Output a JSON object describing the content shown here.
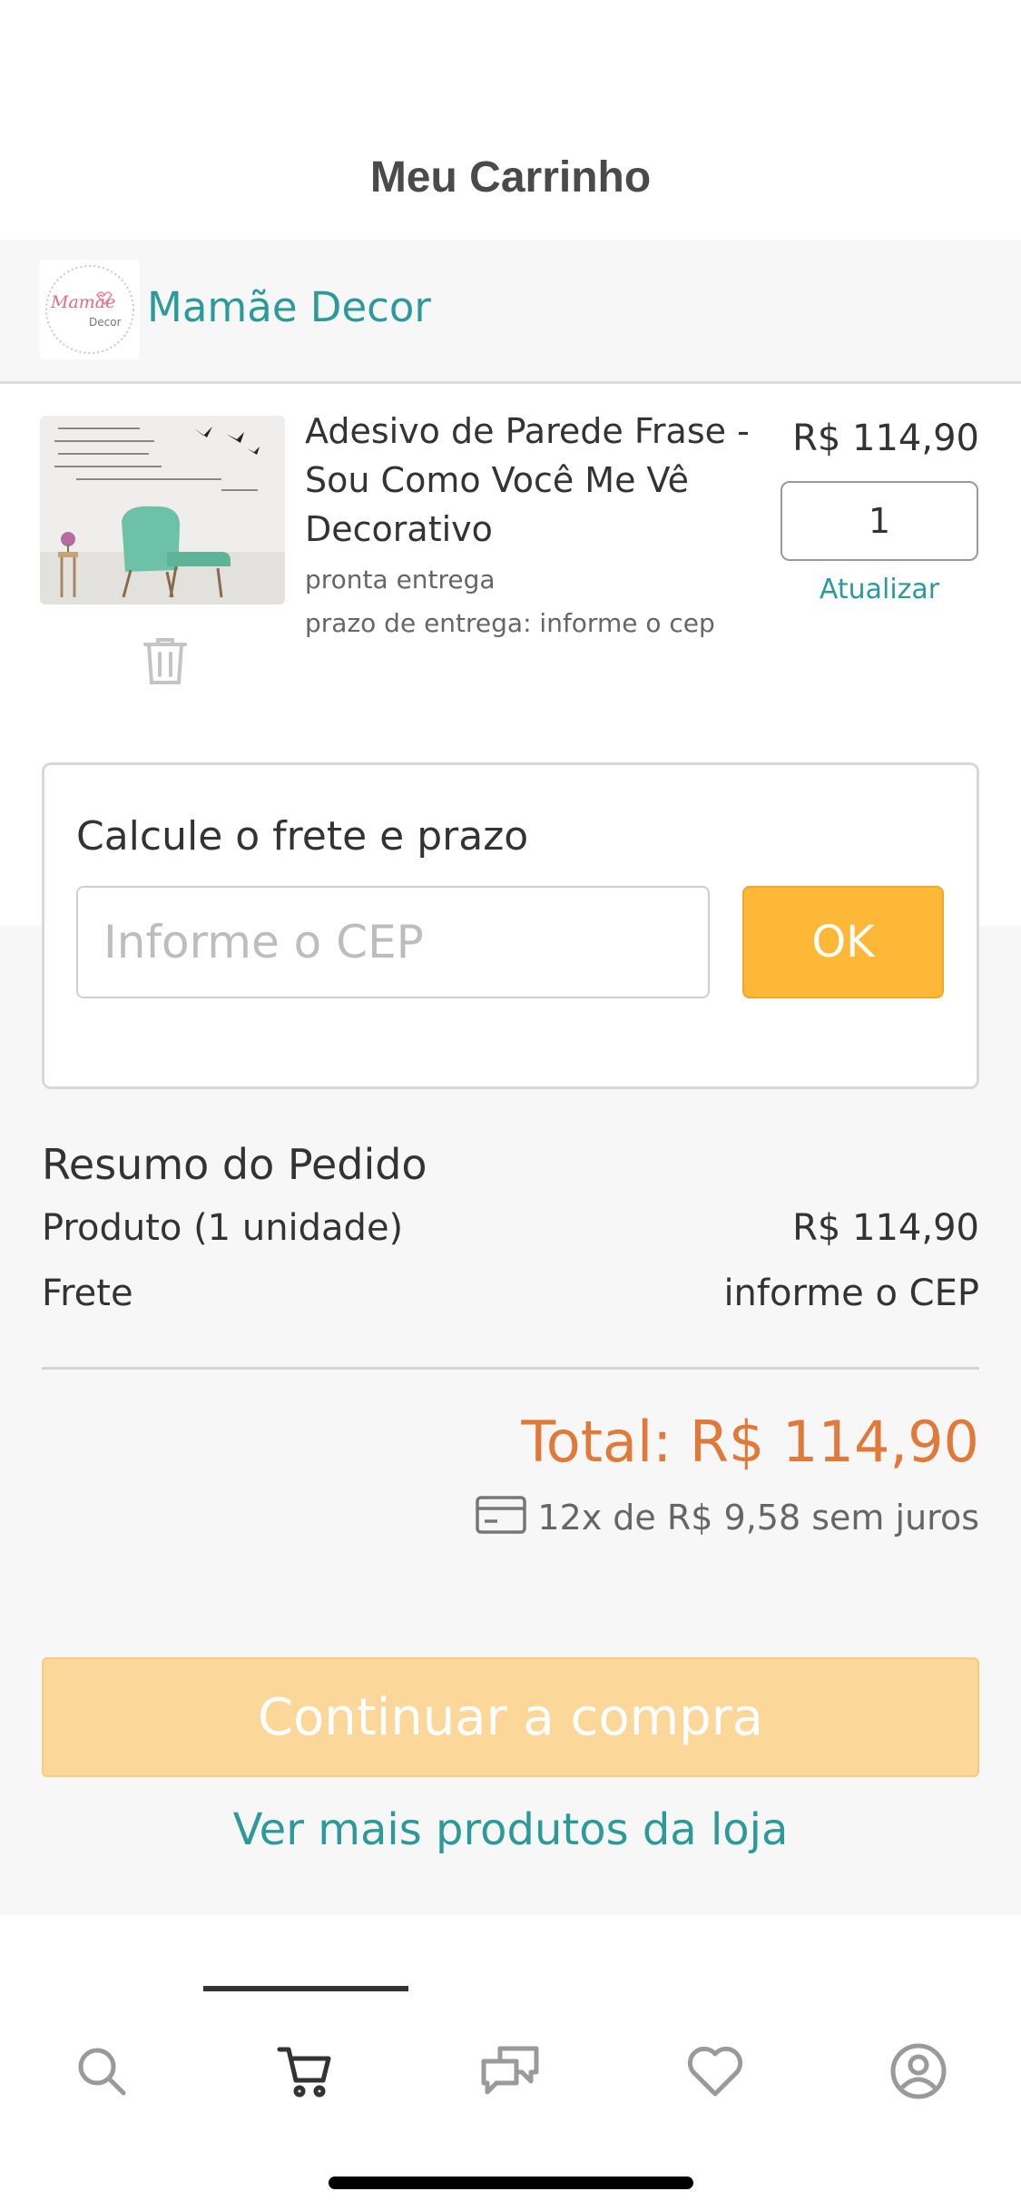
{
  "header": {
    "title": "Meu Carrinho"
  },
  "store": {
    "name": "Mamãe Decor",
    "logo_text": "Mamãe",
    "logo_sub": "Decor"
  },
  "cart_item": {
    "title": "Adesivo de Parede Frase - Sou Como Você Me Vê Decorativo",
    "availability": "pronta entrega",
    "delivery": "prazo de entrega: informe o cep",
    "price": "R$ 114,90",
    "quantity": "1",
    "update_label": "Atualizar"
  },
  "shipping": {
    "title": "Calcule o frete e prazo",
    "placeholder": "Informe o CEP",
    "ok_label": "OK"
  },
  "summary": {
    "title": "Resumo do Pedido",
    "product_label": "Produto (1 unidade)",
    "product_value": "R$ 114,90",
    "shipping_label": "Frete",
    "shipping_value": "informe o CEP",
    "total": "Total: R$ 114,90",
    "installments": "12x de R$ 9,58 sem juros"
  },
  "actions": {
    "continue_label": "Continuar a compra",
    "more_products_label": "Ver mais produtos da loja"
  },
  "bottom_nav": {
    "items": [
      {
        "icon": "search-icon"
      },
      {
        "icon": "cart-icon",
        "active": true
      },
      {
        "icon": "chat-icon"
      },
      {
        "icon": "heart-icon"
      },
      {
        "icon": "account-icon"
      }
    ]
  },
  "colors": {
    "accent": "#2c9a99",
    "ok_button": "#fdb838",
    "continue_button": "#fbd89a",
    "total_text": "#e07a3a"
  }
}
